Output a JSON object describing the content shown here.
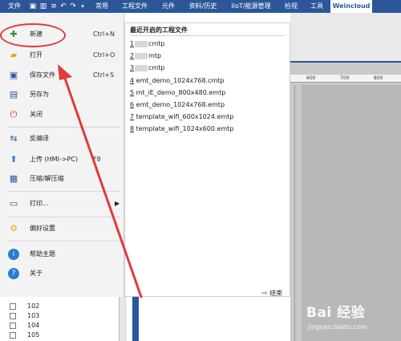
{
  "ribbon": {
    "tabs": [
      "文件",
      "常用",
      "工程文件",
      "元件",
      "资料/历史",
      "IIoT/能源管理",
      "检视",
      "工具",
      "Weincloud"
    ],
    "active_tab": "Weincloud",
    "accent": "#2b579a"
  },
  "file_menu": {
    "items": [
      {
        "label": "新建",
        "shortcut": "Ctrl+N",
        "icon": "new-file-icon"
      },
      {
        "label": "打开",
        "shortcut": "Ctrl+O",
        "icon": "folder-icon"
      },
      {
        "label": "保存文件",
        "shortcut": "Ctrl+S",
        "icon": "save-icon"
      },
      {
        "label": "另存为",
        "shortcut": "",
        "icon": "save-as-icon"
      },
      {
        "label": "关闭",
        "shortcut": "",
        "icon": "power-icon"
      },
      {
        "label": "反编译",
        "shortcut": "",
        "icon": "decompile-icon"
      },
      {
        "label": "上传 (HMI->PC)",
        "shortcut": "F8",
        "icon": "upload-icon"
      },
      {
        "label": "压缩/解压缩",
        "shortcut": "",
        "icon": "compress-icon"
      },
      {
        "label": "打印...",
        "shortcut": "",
        "icon": "print-icon"
      },
      {
        "label": "偏好设置",
        "shortcut": "",
        "icon": "preferences-icon"
      },
      {
        "label": "帮助主题",
        "shortcut": "",
        "icon": "info-icon"
      },
      {
        "label": "关于",
        "shortcut": "",
        "icon": "help-icon"
      }
    ]
  },
  "recent_files": {
    "title": "最近开启的工程文件",
    "files": [
      {
        "num": "1",
        "name": "cmtp",
        "obscured": true
      },
      {
        "num": "2",
        "name": "mtp",
        "obscured": true
      },
      {
        "num": "3",
        "name": "cmtp",
        "obscured": true
      },
      {
        "num": "4",
        "name": "emt_demo_1024x768.cmtp",
        "obscured": false
      },
      {
        "num": "5",
        "name": "mt_iE_demo_800x480.emtp",
        "obscured": false
      },
      {
        "num": "6",
        "name": "emt_demo_1024x768.emtp",
        "obscured": false
      },
      {
        "num": "7",
        "name": "template_wifi_600x1024.emtp",
        "obscured": false
      },
      {
        "num": "8",
        "name": "template_wifi_1024x600.emtp",
        "obscured": false
      }
    ],
    "close_label": "结束"
  },
  "background": {
    "ruler_ticks": [
      "600",
      "700",
      "800"
    ],
    "list_rows": [
      "102",
      "103",
      "104",
      "105"
    ]
  },
  "watermark": {
    "logo": "Bai 经验",
    "url": "jingyan.baidu.com"
  },
  "annotation_color": "#e03b3b"
}
